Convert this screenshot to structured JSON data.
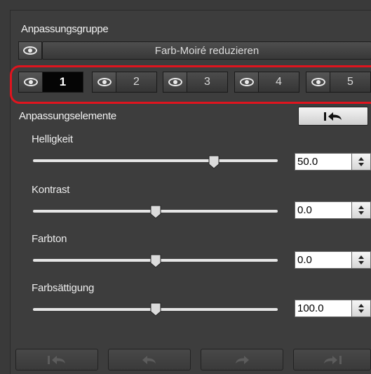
{
  "adjustment_group": {
    "title": "Anpassungsgruppe",
    "selected_group": "Farb-Moiré reduzieren",
    "tabs": [
      {
        "label": "1",
        "active": true
      },
      {
        "label": "2",
        "active": false
      },
      {
        "label": "3",
        "active": false
      },
      {
        "label": "4",
        "active": false
      },
      {
        "label": "5",
        "active": false
      }
    ]
  },
  "adjustment_elements": {
    "title": "Anpassungselemente",
    "reset_icon": "reset-to-start-icon",
    "sliders": [
      {
        "label": "Helligkeit",
        "value": "50.0",
        "level": 0.75
      },
      {
        "label": "Kontrast",
        "value": "0.0",
        "level": 0.5
      },
      {
        "label": "Farbton",
        "value": "0.0",
        "level": 0.5
      },
      {
        "label": "Farbsättigung",
        "value": "100.0",
        "level": 0.5
      }
    ]
  },
  "bottom_nav": {
    "icons": [
      "first-step-icon",
      "undo-icon",
      "redo-icon",
      "last-step-icon"
    ]
  },
  "colors": {
    "highlight_ring": "#e0141e",
    "panel_bg": "#3d3d3d"
  }
}
